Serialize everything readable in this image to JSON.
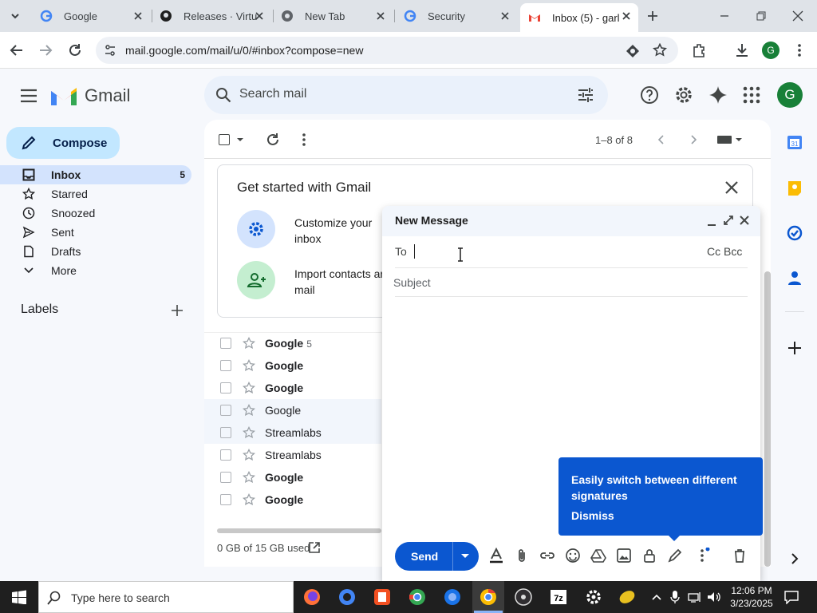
{
  "browser": {
    "tabs": [
      {
        "label": "Google",
        "icon": "google-icon"
      },
      {
        "label": "Releases · Virtu",
        "icon": "github-icon"
      },
      {
        "label": "New Tab",
        "icon": "chrome-icon"
      },
      {
        "label": "Security",
        "icon": "google-icon"
      },
      {
        "label": "Inbox (5) - garl",
        "icon": "gmail-icon",
        "active": true
      }
    ],
    "url": "mail.google.com/mail/u/0/#inbox?compose=new",
    "profile_initial": "G"
  },
  "gmail": {
    "logo_text": "Gmail",
    "search_placeholder": "Search mail",
    "avatar_initial": "G",
    "compose_label": "Compose",
    "nav": [
      {
        "label": "Inbox",
        "count": "5",
        "icon": "inbox-icon",
        "selected": true
      },
      {
        "label": "Starred",
        "icon": "star-icon"
      },
      {
        "label": "Snoozed",
        "icon": "clock-icon"
      },
      {
        "label": "Sent",
        "icon": "send-icon"
      },
      {
        "label": "Drafts",
        "icon": "draft-icon"
      },
      {
        "label": "More",
        "icon": "chevron-down-icon"
      }
    ],
    "labels_title": "Labels",
    "pagination": "1–8 of 8",
    "get_started": {
      "title": "Get started with Gmail",
      "items": [
        {
          "text": "Customize your inbox",
          "icon": "gear-icon"
        },
        {
          "text": "Import contacts and mail",
          "icon": "add-person-icon"
        }
      ]
    },
    "messages": [
      {
        "sender": "Google",
        "count": "5",
        "unread": true
      },
      {
        "sender": "Google",
        "count": "",
        "unread": true
      },
      {
        "sender": "Google",
        "count": "",
        "unread": true
      },
      {
        "sender": "Google",
        "count": "",
        "unread": false
      },
      {
        "sender": "Streamlabs",
        "count": "",
        "unread": false
      },
      {
        "sender": "Streamlabs",
        "count": "",
        "unread": false
      },
      {
        "sender": "Google",
        "count": "",
        "unread": true
      },
      {
        "sender": "Google",
        "count": "",
        "unread": true
      }
    ],
    "storage": "0 GB of 15 GB used"
  },
  "compose_window": {
    "title": "New Message",
    "to_label": "To",
    "to_value": "",
    "cc_bcc": "Cc Bcc",
    "subject_placeholder": "Subject",
    "send_label": "Send"
  },
  "tooltip": {
    "text": "Easily switch between different signatures",
    "dismiss": "Dismiss"
  },
  "taskbar": {
    "search_placeholder": "Type here to search",
    "time": "12:06 PM",
    "date": "3/23/2025"
  },
  "colors": {
    "accent": "#0b57d0",
    "compose_bg": "#c2e7ff",
    "nav_selected": "#d3e3fd",
    "gmail_red": "#ea4335",
    "gmail_blue": "#4285f4",
    "gmail_green": "#34a853",
    "gmail_yellow": "#fbbc04"
  }
}
